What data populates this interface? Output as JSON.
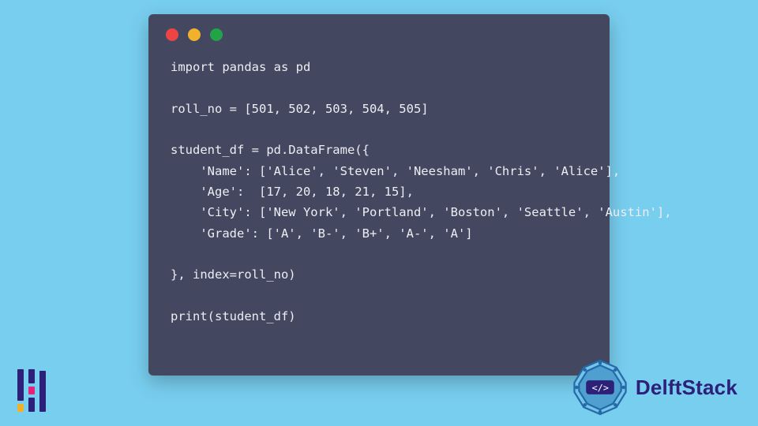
{
  "code": {
    "lines": [
      "import pandas as pd",
      "",
      "roll_no = [501, 502, 503, 504, 505]",
      "",
      "student_df = pd.DataFrame({",
      "    'Name': ['Alice', 'Steven', 'Neesham', 'Chris', 'Alice'],",
      "    'Age':  [17, 20, 18, 21, 15],",
      "    'City': ['New York', 'Portland', 'Boston', 'Seattle', 'Austin'],",
      "    'Grade': ['A', 'B-', 'B+', 'A-', 'A']",
      "",
      "}, index=roll_no)",
      "",
      "print(student_df)"
    ]
  },
  "brand": {
    "name": "DelftStack"
  }
}
